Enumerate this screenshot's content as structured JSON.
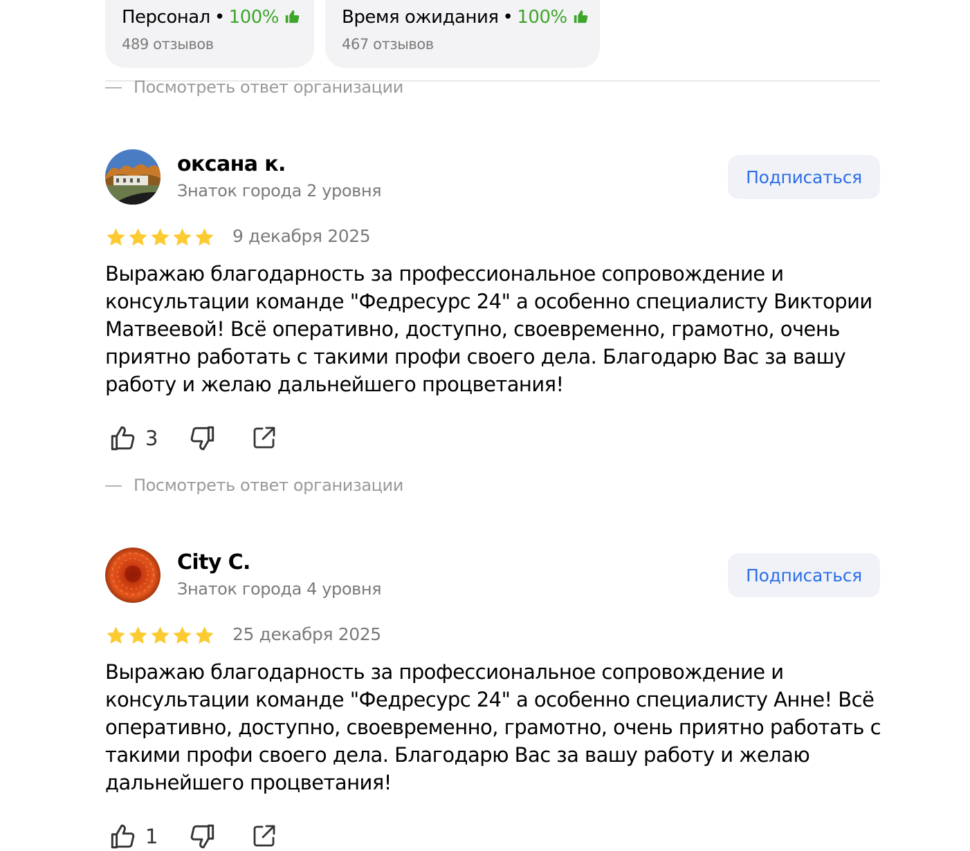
{
  "aspects": [
    {
      "name": "Персонал",
      "separator": "•",
      "percent": "100%",
      "count": "489 отзывов",
      "icon": "thumbs-up-icon"
    },
    {
      "name": "Время ожидания",
      "separator": "•",
      "percent": "100%",
      "count": "467 отзывов",
      "icon": "thumbs-up-icon"
    }
  ],
  "org_reply_label": "Посмотреть ответ организации",
  "reviews": [
    {
      "author": "оксана к.",
      "level": "Знаток города 2 уровня",
      "subscribe_label": "Подписаться",
      "rating": 5,
      "date": "9 декабря 2025",
      "text": "Выражаю благодарность за профессиональное сопровождение и консультации команде \"Федресурс 24\" а особенно специалисту Виктории Матвеевой! Всё оперативно, доступно, своевременно, грамотно, очень приятно работать с такими профи своего дела. Благодарю Вас за вашу работу и желаю дальнейшего процветания!",
      "likes": "3",
      "reply_label": "Посмотреть ответ организации"
    },
    {
      "author": "City C.",
      "level": "Знаток города 4 уровня",
      "subscribe_label": "Подписаться",
      "rating": 5,
      "date": "25 декабря 2025",
      "text": "Выражаю благодарность за профессиональное сопровождение и консультации команде \"Федресурс 24\" а особенно специалисту Анне! Всё оперативно, доступно, своевременно, грамотно, очень приятно работать с такими профи своего дела. Благодарю Вас за вашу работу и желаю дальнейшего процветания!",
      "likes": "1"
    }
  ],
  "colors": {
    "accent": "#2c6ee8",
    "star": "#fcca31",
    "positive": "#3ea52b",
    "muted": "#7a7a7a"
  }
}
